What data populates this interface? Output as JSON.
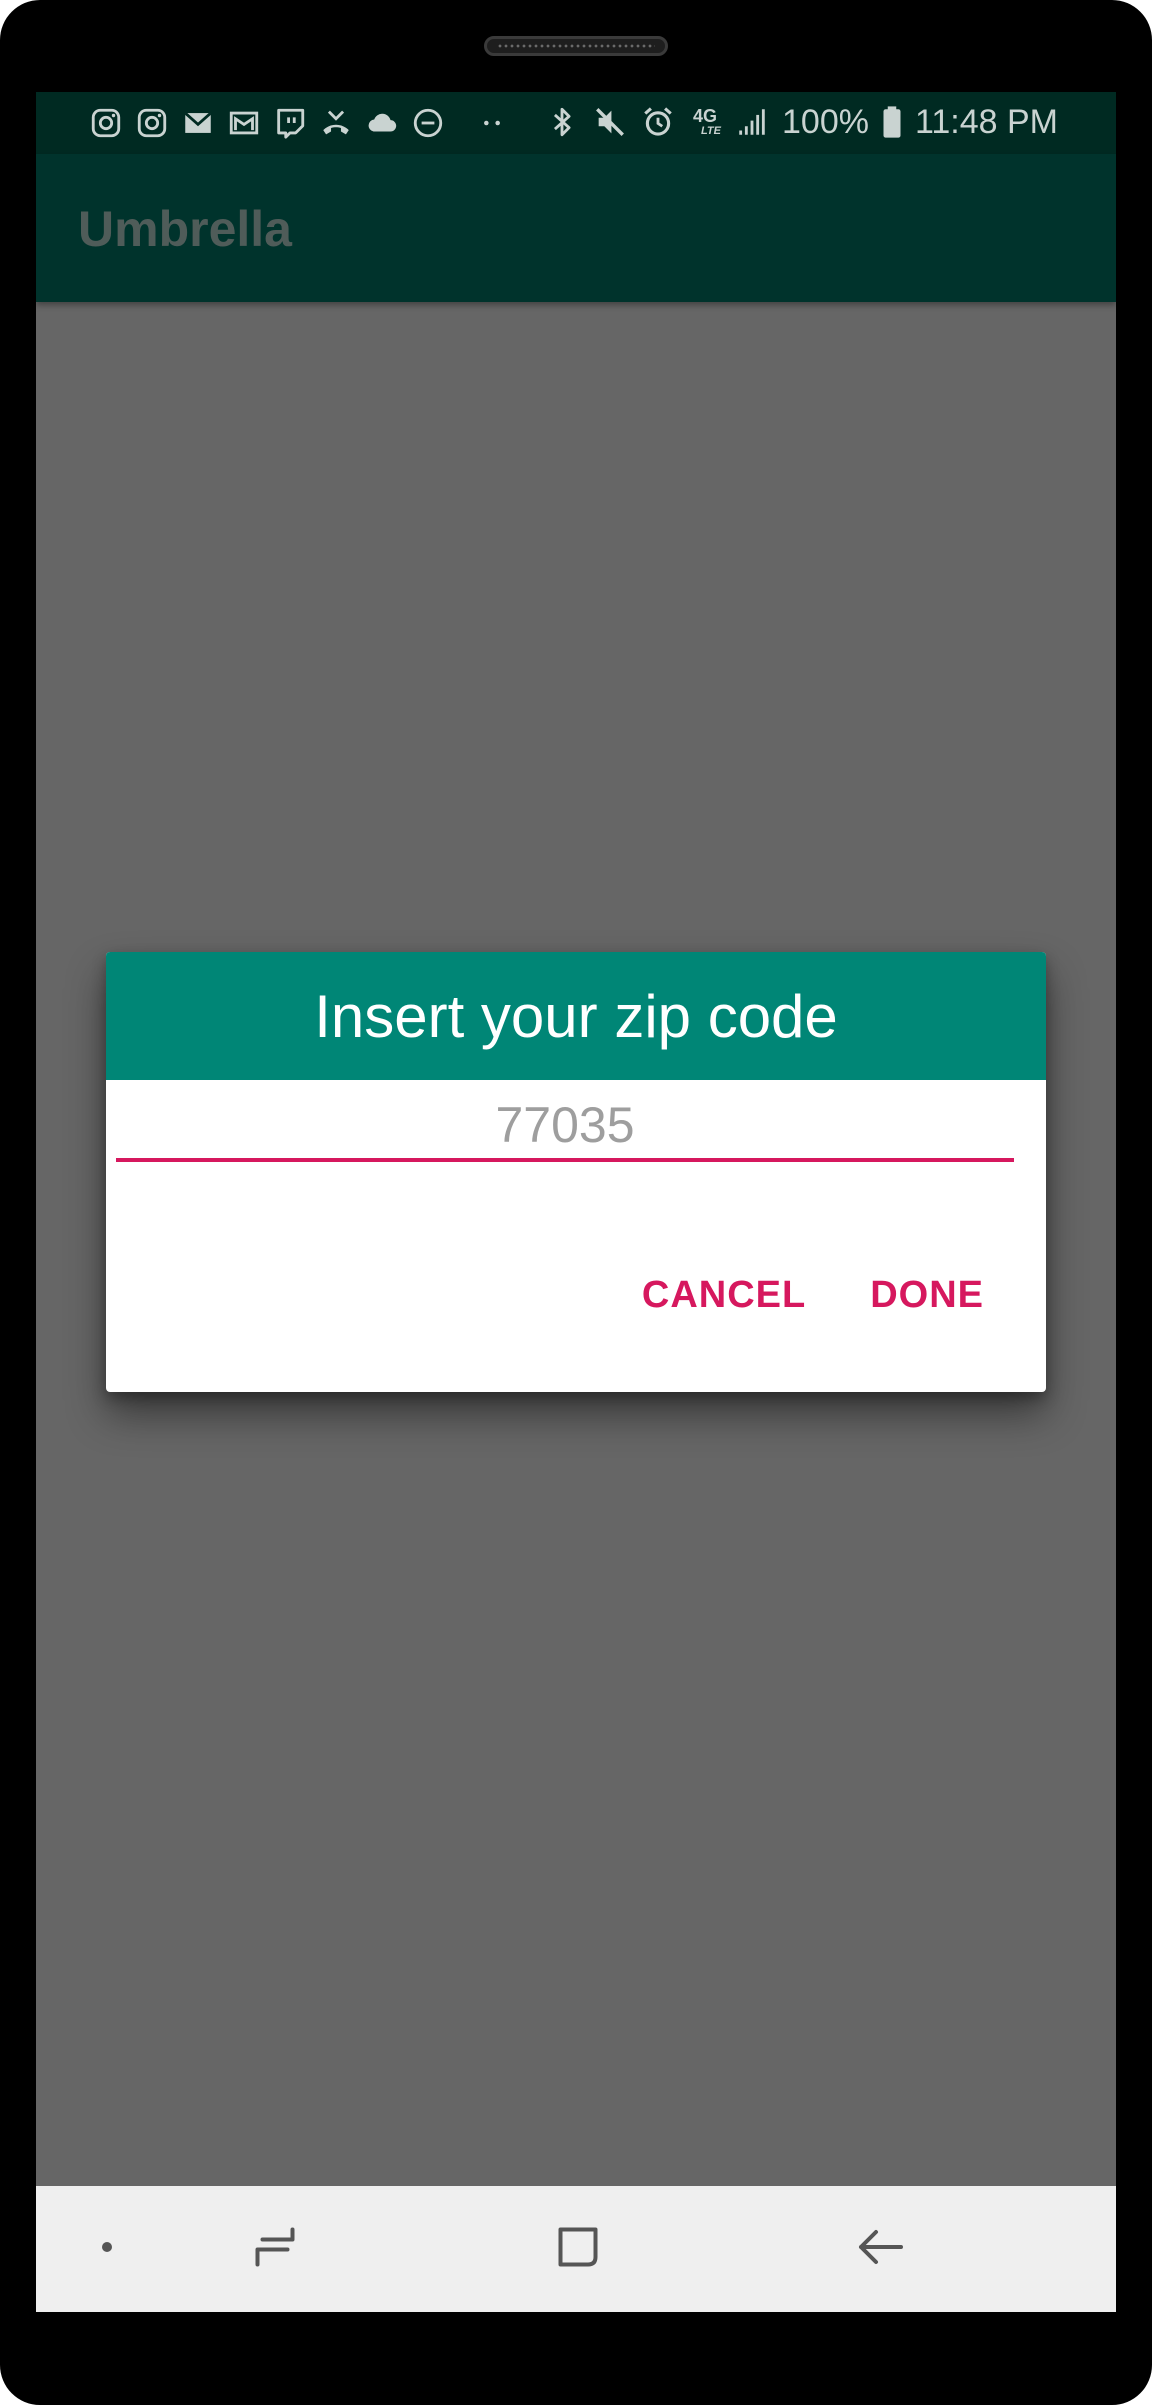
{
  "status_bar": {
    "battery_percent": "100%",
    "time": "11:48 PM",
    "left_icons": [
      "instagram-icon",
      "instagram-icon",
      "gmail-icon",
      "gmail-outline-icon",
      "twitch-icon",
      "missed-call-icon",
      "cloud-icon",
      "do-not-disturb-icon",
      "more-dots-icon"
    ],
    "right_icons": [
      "bluetooth-icon",
      "mute-icon",
      "alarm-icon",
      "lte-4g-icon",
      "signal-icon",
      "battery-icon"
    ],
    "network_label": "4G",
    "network_sub_label": "LTE"
  },
  "app_bar": {
    "title": "Umbrella"
  },
  "dialog": {
    "title": "Insert your zip code",
    "zip_input": {
      "value": "77035"
    },
    "cancel_label": "CANCEL",
    "done_label": "DONE"
  },
  "nav_bar": {
    "items": [
      "dot-icon",
      "recents-icon",
      "home-icon",
      "back-icon"
    ]
  },
  "colors": {
    "status_bar_bg": "#002a22",
    "app_bar_bg": "#00332c",
    "dialog_header_bg": "#008676",
    "accent": "#d6185e",
    "scrim": "#666666"
  }
}
